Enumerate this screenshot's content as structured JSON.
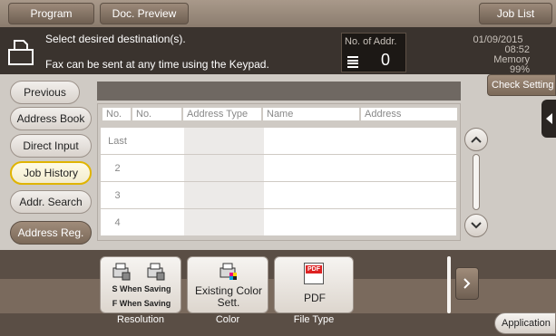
{
  "topbar": {
    "program": "Program",
    "doc_preview": "Doc. Preview",
    "job_list": "Job List"
  },
  "status": {
    "line1": "Select desired destination(s).",
    "line2": "Fax can be sent at any time using the Keypad.",
    "no_of_addr_label": "No. of Addr.",
    "no_of_addr_value": "0",
    "date": "01/09/2015",
    "time": "08:52",
    "memory_label": "Memory",
    "memory_value": "99%"
  },
  "sidebar": {
    "previous": "Previous",
    "items": [
      "Address Book",
      "Direct Input",
      "Job History",
      "Addr. Search",
      "Address Reg."
    ],
    "selected": "Job History"
  },
  "check_setting": "Check Setting",
  "table": {
    "headers": [
      "No.",
      "No.",
      "Address Type",
      "Name",
      "Address"
    ],
    "rows": [
      "Last",
      "2",
      "3",
      "4"
    ]
  },
  "functions": {
    "resolution": {
      "line1": "S When Saving",
      "line2": "F When Saving",
      "label": "Resolution"
    },
    "color": {
      "value": "Existing Color Sett.",
      "label": "Color"
    },
    "file_type": {
      "value": "PDF",
      "label": "File Type",
      "icon_text": "PDF"
    }
  },
  "application": "Application",
  "colors": {
    "accent_yellow": "#e0b400",
    "top_bar": "#8b7c6e",
    "status_bg": "#3a332e"
  }
}
